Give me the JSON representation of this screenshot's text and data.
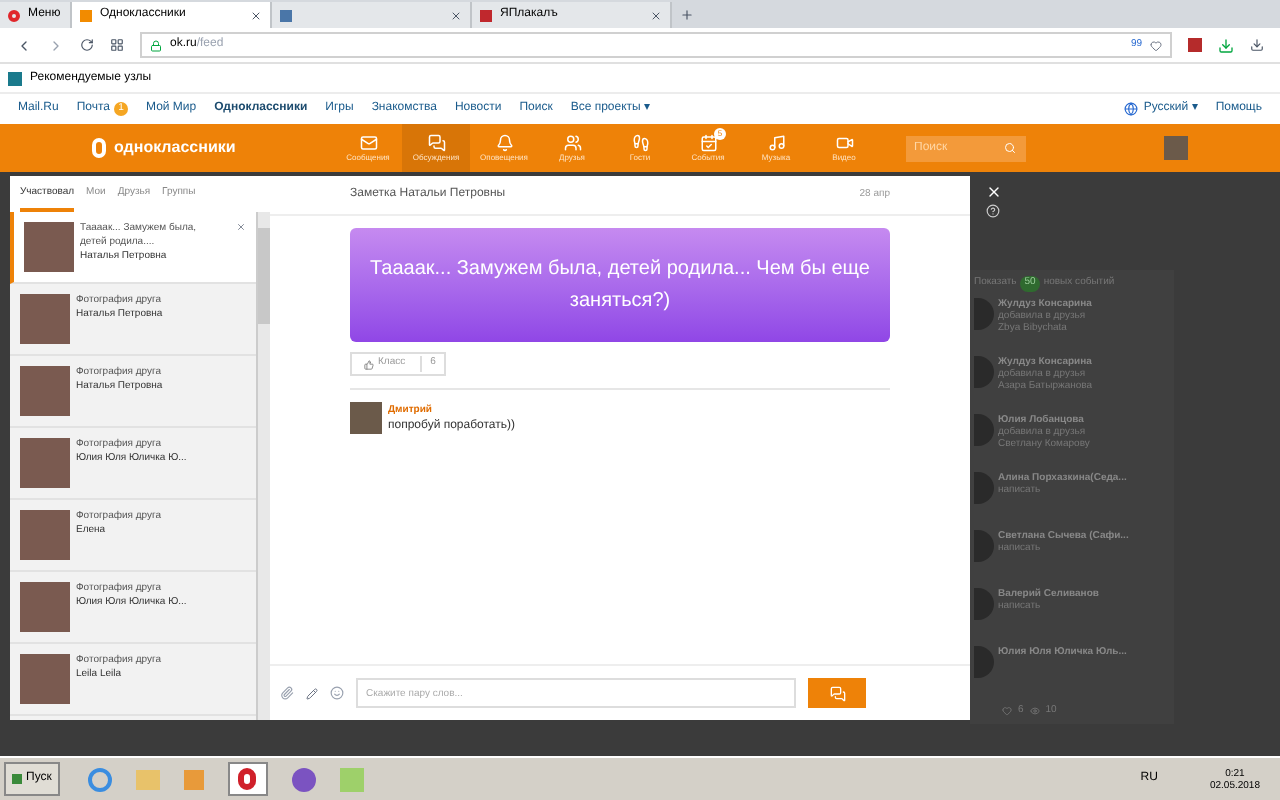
{
  "browser_tabs": [
    {
      "label": "Меню",
      "kind": "menu",
      "selected": false
    },
    {
      "label": "Одноклассники",
      "kind": "site",
      "selected": true
    },
    {
      "kind": "hidden",
      "selected": false
    },
    {
      "label": "ЯПлакалъ",
      "kind": "site",
      "selected": false
    }
  ],
  "address_bar": {
    "domain": "ok.ru",
    "path": "/feed",
    "badge": "99"
  },
  "bookmarks": {
    "label": "Рекомендуемые узлы"
  },
  "portal_nav": {
    "items": [
      {
        "label": "Mail.Ru",
        "selected": false
      },
      {
        "label": "Почта",
        "selected": false,
        "badge": "1"
      },
      {
        "label": "Мой Мир",
        "selected": false
      },
      {
        "label": "Одноклассники",
        "selected": true
      },
      {
        "label": "Игры",
        "selected": false
      },
      {
        "label": "Знакомства",
        "selected": false
      },
      {
        "label": "Новости",
        "selected": false
      },
      {
        "label": "Поиск",
        "selected": false
      },
      {
        "label": "Все проекты ▾",
        "selected": false
      }
    ],
    "language": "Русский ▾",
    "help": "Помощь"
  },
  "site_header": {
    "logo": "одноклассники",
    "search_placeholder": "Поиск",
    "items": [
      {
        "kind": "mail",
        "label": "Сообщения",
        "selected": false
      },
      {
        "kind": "chat",
        "label": "Обсуждения",
        "selected": true
      },
      {
        "kind": "bell",
        "label": "Оповещения",
        "selected": false
      },
      {
        "kind": "users",
        "label": "Друзья",
        "selected": false
      },
      {
        "kind": "steps",
        "label": "Гости",
        "selected": false
      },
      {
        "kind": "events",
        "label": "События",
        "selected": false,
        "badge": "5"
      },
      {
        "kind": "music",
        "label": "Музыка",
        "selected": false
      },
      {
        "kind": "video",
        "label": "Видео",
        "selected": false
      }
    ]
  },
  "discussions": {
    "tabs": [
      {
        "label": "Участвовал",
        "selected": true
      },
      {
        "label": "Мои",
        "selected": false
      },
      {
        "label": "Друзья",
        "selected": false
      },
      {
        "label": "Группы",
        "selected": false
      }
    ],
    "items": [
      {
        "title": "Тааaак... Замужем была, детей родила....",
        "author": "Наталья Петровна",
        "selected": true
      },
      {
        "title": "Фотография друга",
        "author": "Наталья Петровна",
        "selected": false
      },
      {
        "title": "Фотография друга",
        "author": "Наталья Петровна",
        "selected": false
      },
      {
        "title": "Фотография друга",
        "author": "Юлия Юля Юличка Ю...",
        "selected": false
      },
      {
        "title": "Фотография друга",
        "author": "Елена",
        "selected": false
      },
      {
        "title": "Фотография друга",
        "author": "Юлия Юля Юличка Ю...",
        "selected": false
      },
      {
        "title": "Фотография друга",
        "author": "Leila Leila",
        "selected": false
      }
    ]
  },
  "topic": {
    "title": "Заметка Натальи Петровны",
    "date": "28 апр",
    "text": "Тааaак... Замужем была, детей родила... Чем бы еще заняться?)",
    "like_label": "Класс",
    "like_count": "6",
    "comments": [
      {
        "author": "Дмитрий",
        "text": "попробуй поработать))"
      }
    ],
    "input_placeholder": "Скажите пару слов..."
  },
  "feed": {
    "show_new": "Показать",
    "new_count": "50",
    "new_label": "новых событий",
    "entries": [
      {
        "name": "Жулдуз Консарина",
        "line1": "добавила в друзья",
        "line2": "Zbya Bibychata"
      },
      {
        "name": "Жулдуз Консарина",
        "line1": "добавила в друзья",
        "line2": "Азара Батыржанова"
      },
      {
        "name": "Юлия Лобанцова",
        "line1": "добавила в друзья",
        "line2": "Светлану Комарову"
      },
      {
        "name": "Алина Порхазкина(Седа...",
        "line1": "написать"
      },
      {
        "name": "Светлана Сычева (Сафи...",
        "line1": "написать"
      },
      {
        "name": "Валерий Селиванов",
        "line1": "написать"
      },
      {
        "name": "Юлия Юля Юличка Юль..."
      }
    ],
    "likes": "6",
    "views": "10"
  },
  "taskbar": {
    "start": "Пуск",
    "language": "RU",
    "time": "0:21",
    "date": "02.05.2018"
  }
}
